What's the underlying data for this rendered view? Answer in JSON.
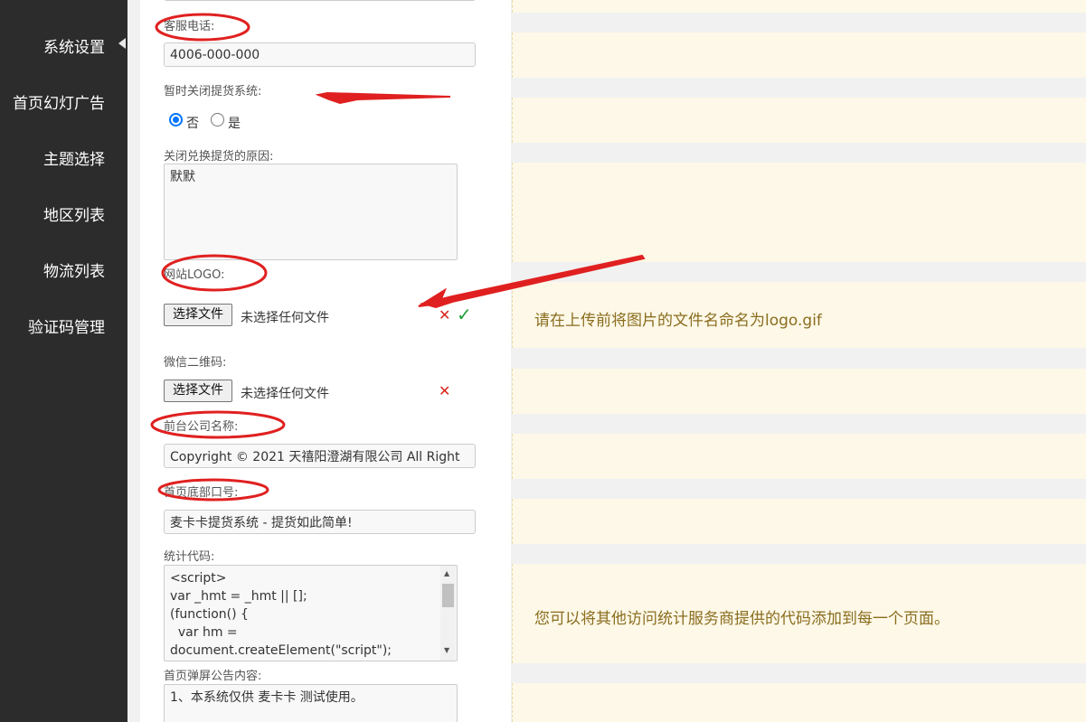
{
  "sidebar": {
    "items": [
      {
        "label": "系统设置"
      },
      {
        "label": "首页幻灯广告"
      },
      {
        "label": "主题选择"
      },
      {
        "label": "地区列表"
      },
      {
        "label": "物流列表"
      },
      {
        "label": "验证码管理"
      }
    ]
  },
  "form": {
    "hotline": {
      "label": "客服电话:",
      "value": "4006-000-000"
    },
    "close_system": {
      "label": "暂时关闭提货系统:",
      "options": [
        {
          "label": "否",
          "checked": true
        },
        {
          "label": "是",
          "checked": false
        }
      ]
    },
    "close_reason": {
      "label": "关闭兑换提货的原因:",
      "value": "默默"
    },
    "logo": {
      "label": "网站LOGO:",
      "button": "选择文件",
      "status": "未选择任何文件"
    },
    "wechat_qr": {
      "label": "微信二维码:",
      "button": "选择文件",
      "status": "未选择任何文件"
    },
    "company_name": {
      "label": "前台公司名称:",
      "value": "Copyright © 2021 天禧阳澄湖有限公司 All Right"
    },
    "footer_slogan": {
      "label": "首页底部口号:",
      "value": "麦卡卡提货系统 - 提货如此简单!"
    },
    "stats_code": {
      "label": "统计代码:",
      "value": "<script>\nvar _hmt = _hmt || [];\n(function() {\n  var hm =\ndocument.createElement(\"script\");"
    },
    "popup_notice": {
      "label": "首页弹屏公告内容:",
      "value": "1、本系统仅供 麦卡卡 测试使用。"
    }
  },
  "tips": {
    "logo_tip": "请在上传前将图片的文件名命名为logo.gif",
    "stats_tip": "您可以将其他访问统计服务商提供的代码添加到每一个页面。"
  },
  "icons": {
    "remove": "✕",
    "confirm": "✓"
  },
  "colors": {
    "sidebar_bg": "#2c2c2c",
    "tip_bg": "#fdf8e7",
    "tip_text": "#8a6d1f",
    "annotation": "#e02020",
    "radio_accent": "#0075ff"
  }
}
